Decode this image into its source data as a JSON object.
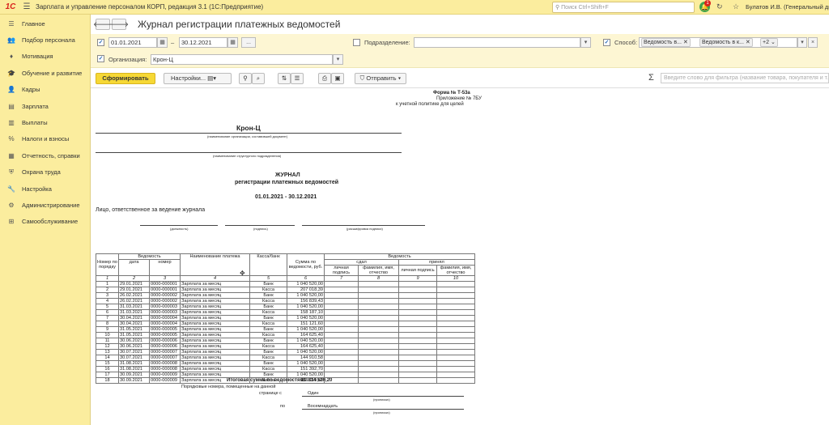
{
  "titlebar": {
    "app_title": "Зарплата и управление персоналом КОРП, редакция 3.1  (1С:Предприятие)",
    "logo": "1С",
    "search_placeholder": "Поиск Ctrl+Shift+F",
    "notif_count": "1",
    "user": "Булатов И.В. (Генеральный директор)"
  },
  "sidebar": {
    "items": [
      {
        "label": "Главное",
        "icon": "menu-icon"
      },
      {
        "label": "Подбор персонала",
        "icon": "people-icon"
      },
      {
        "label": "Мотивация",
        "icon": "gift-icon"
      },
      {
        "label": "Обучение и развитие",
        "icon": "graduation-icon"
      },
      {
        "label": "Кадры",
        "icon": "person-icon"
      },
      {
        "label": "Зарплата",
        "icon": "money-icon"
      },
      {
        "label": "Выплаты",
        "icon": "wallet-icon"
      },
      {
        "label": "Налоги и взносы",
        "icon": "percent-icon"
      },
      {
        "label": "Отчетность, справки",
        "icon": "chart-icon"
      },
      {
        "label": "Охрана труда",
        "icon": "shield-icon"
      },
      {
        "label": "Настройка",
        "icon": "wrench-icon"
      },
      {
        "label": "Администрирование",
        "icon": "gear-icon"
      },
      {
        "label": "Самообслуживание",
        "icon": "selfservice-icon"
      }
    ]
  },
  "header": {
    "title": "Журнал регистрации платежных ведомостей"
  },
  "filters": {
    "date_from": "01.01.2021",
    "date_to": "30.12.2021",
    "dash": "–",
    "dots": "...",
    "subdivision_label": "Подразделение:",
    "subdivision_value": "",
    "method_label": "Способ:",
    "chip1": "Ведомость в...",
    "chip2": "Ведомость в к...",
    "chip_more": "+2",
    "org_label": "Организация:",
    "org_value": "Крон-Ц"
  },
  "toolbar": {
    "generate": "Сформировать",
    "settings": "Настройки...",
    "send": "Отправить",
    "filter_placeholder": "Введите слово для фильтра (название товара, покупателя и т.д.)"
  },
  "report": {
    "form_no": "Форма № Т-53а",
    "appendix": "Приложение № 7БУ",
    "policy": "к учетной политике для целей",
    "org": "Крон-Ц",
    "org_caption": "(наименование организации, составившей документ)",
    "sub_caption": "(наименование структурного подразделения)",
    "journal": "ЖУРНАЛ",
    "journal_sub": "регистрации платежных ведомостей",
    "period": "01.01.2021 - 30.12.2021",
    "responsible": "Лицо, ответственное за ведение журнала",
    "cap_position": "(должность)",
    "cap_signature": "(подпись)",
    "cap_decoding": "(расшифровка подписи)",
    "total_label": "Итоговая сумма по ведомостям:",
    "total_value": "10 814 520,20",
    "ordinal_label": "Порядковые номера, помещенные на данной",
    "page_from": "странице с",
    "from_value": "Один",
    "to_label": "по",
    "to_value": "Восемнадцать",
    "cap_words": "(прописью)"
  },
  "table": {
    "h_num": "Номер по порядку",
    "h_sheet": "Ведомость",
    "h_date": "дата",
    "h_number": "номер",
    "h_name": "Наименование платежа",
    "h_cash": "Касса/банк",
    "h_sum": "Сумма по ведомости, руб.",
    "h_issued": "сдал",
    "h_accepted": "принял",
    "h_sign": "личная подпись",
    "h_fio": "фамилия, имя, отчество",
    "colnums": [
      "1",
      "2",
      "3",
      "4",
      "5",
      "6",
      "7",
      "8",
      "9",
      "10"
    ],
    "rows": [
      [
        "1",
        "29.01.2021",
        "0000-000001",
        "Зарплата за месяц",
        "Банк",
        "1 040 520,00"
      ],
      [
        "2",
        "29.01.2021",
        "0000-000001",
        "Зарплата за месяц",
        "Касса",
        "207 018,39"
      ],
      [
        "3",
        "26.02.2021",
        "0000-000002",
        "Зарплата за месяц",
        "Банк",
        "1 040 520,00"
      ],
      [
        "4",
        "26.02.2021",
        "0000-000002",
        "Зарплата за месяц",
        "Касса",
        "156 839,43"
      ],
      [
        "5",
        "31.03.2021",
        "0000-000003",
        "Зарплата за месяц",
        "Банк",
        "1 040 520,00"
      ],
      [
        "6",
        "31.03.2021",
        "0000-000003",
        "Зарплата за месяц",
        "Касса",
        "158 187,10"
      ],
      [
        "7",
        "30.04.2021",
        "0000-000004",
        "Зарплата за месяц",
        "Банк",
        "1 040 520,00"
      ],
      [
        "8",
        "30.04.2021",
        "0000-000004",
        "Зарплата за месяц",
        "Касса",
        "151 121,60"
      ],
      [
        "9",
        "31.05.2021",
        "0000-000005",
        "Зарплата за месяц",
        "Банк",
        "1 040 520,00"
      ],
      [
        "10",
        "31.05.2021",
        "0000-000005",
        "Зарплата за месяц",
        "Касса",
        "164 625,40"
      ],
      [
        "11",
        "30.06.2021",
        "0000-000006",
        "Зарплата за месяц",
        "Банк",
        "1 040 520,00"
      ],
      [
        "12",
        "30.06.2021",
        "0000-000006",
        "Зарплата за месяц",
        "Касса",
        "164 625,40"
      ],
      [
        "13",
        "30.07.2021",
        "0000-000007",
        "Зарплата за месяц",
        "Банк",
        "1 040 520,00"
      ],
      [
        "14",
        "30.07.2021",
        "0000-000007",
        "Зарплата за месяц",
        "Касса",
        "144 910,58"
      ],
      [
        "15",
        "31.08.2021",
        "0000-000008",
        "Зарплата за месяц",
        "Банк",
        "1 040 520,00"
      ],
      [
        "16",
        "31.08.2021",
        "0000-000008",
        "Зарплата за месяц",
        "Касса",
        "151 392,70"
      ],
      [
        "17",
        "30.09.2021",
        "0000-000009",
        "Зарплата за месяц",
        "Банк",
        "1 040 520,00"
      ],
      [
        "18",
        "30.09.2021",
        "0000-000009",
        "Зарплата за месяц",
        "Касса",
        "151 119,60"
      ]
    ]
  }
}
